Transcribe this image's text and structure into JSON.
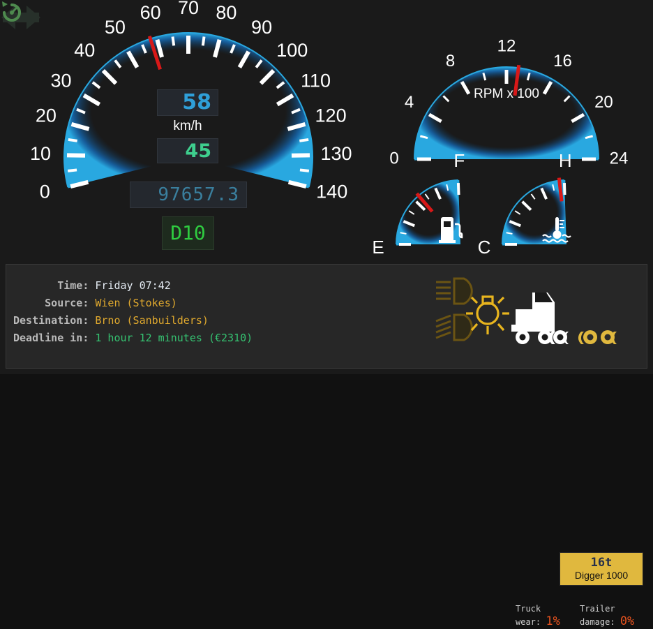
{
  "theme": {
    "background": "#1a1a1a",
    "arc_color": "#29a8e0",
    "tick_color": "#ffffff",
    "needle_color": "#d81818",
    "panel_bg": "#272727",
    "cargo_tag_bg": "#e0b83e"
  },
  "speedometer": {
    "name": "speedometer",
    "unit": "km/h",
    "min": 0,
    "max": 140,
    "major_step": 10,
    "minor_step": 5,
    "labels": [
      0,
      10,
      20,
      30,
      40,
      50,
      60,
      70,
      80,
      90,
      100,
      110,
      120,
      130,
      140
    ],
    "needle_value": 58,
    "speed_value": "58",
    "cruise_value": "45",
    "odometer": "97657.3",
    "gear": "D10"
  },
  "tachometer": {
    "name": "tachometer",
    "caption": "RPM x 100",
    "min": 0,
    "max": 24,
    "major_step": 4,
    "minor_step": 2,
    "labels": [
      0,
      4,
      8,
      12,
      16,
      20,
      24
    ],
    "needle_value": 13
  },
  "fuel_gauge": {
    "name": "fuel-gauge",
    "low_label": "E",
    "high_label": "F",
    "needle_fraction": 0.56
  },
  "temp_gauge": {
    "name": "temperature-gauge",
    "low_label": "C",
    "high_label": "H",
    "needle_fraction": 0.95
  },
  "indicators": {
    "turn_left": "inactive",
    "turn_right": "inactive",
    "low_beam": "inactive",
    "high_beam": "inactive",
    "parking_lights": "active",
    "cruise_control": "active"
  },
  "trip": {
    "rows": [
      {
        "label": "Time:",
        "value": "Friday 07:42",
        "style": "v-time"
      },
      {
        "label": "Source:",
        "value": "Wien (Stokes)",
        "style": "v-src"
      },
      {
        "label": "Destination:",
        "value": "Brno (Sanbuilders)",
        "style": "v-dst"
      },
      {
        "label": "Deadline in:",
        "value": "1 hour 12 minutes (€2310)",
        "style": "v-dl"
      }
    ]
  },
  "cargo": {
    "weight": "16t",
    "name": "Digger 1000"
  },
  "damage": {
    "truck_line1": "Truck",
    "truck_line2": "wear:",
    "truck_value": "1%",
    "trailer_line1": "Trailer",
    "trailer_line2": "damage:",
    "trailer_value": "0%"
  }
}
